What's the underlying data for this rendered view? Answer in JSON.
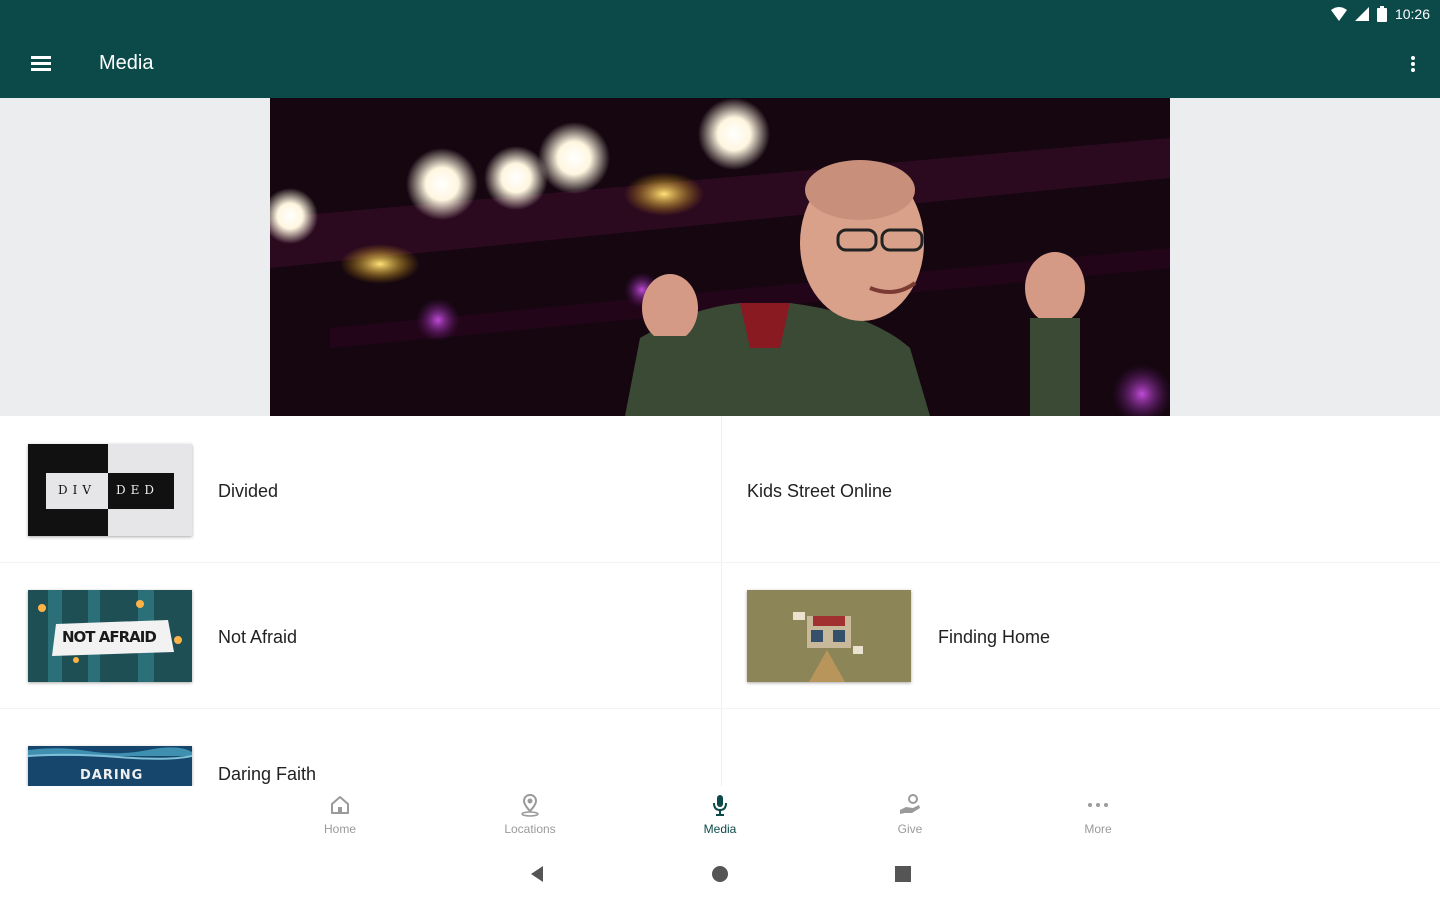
{
  "status_bar": {
    "time": "10:26"
  },
  "app_bar": {
    "title": "Media"
  },
  "media_items": [
    {
      "title": "Divided"
    },
    {
      "title": "Kids Street Online"
    },
    {
      "title": "Not Afraid"
    },
    {
      "title": "Finding Home"
    },
    {
      "title": "Daring Faith"
    }
  ],
  "thumb_text": {
    "divided_left": "DIV",
    "divided_right": "DED",
    "not_afraid": "NOT AFRAID",
    "daring": "DARING"
  },
  "bottom_nav": [
    {
      "label": "Home",
      "icon": "home-icon"
    },
    {
      "label": "Locations",
      "icon": "location-pin-icon"
    },
    {
      "label": "Media",
      "icon": "microphone-icon",
      "active": true
    },
    {
      "label": "Give",
      "icon": "give-hand-icon"
    },
    {
      "label": "More",
      "icon": "more-horizontal-icon"
    }
  ],
  "colors": {
    "primary": "#0c4a4a",
    "inactive": "#9a9a9a"
  }
}
